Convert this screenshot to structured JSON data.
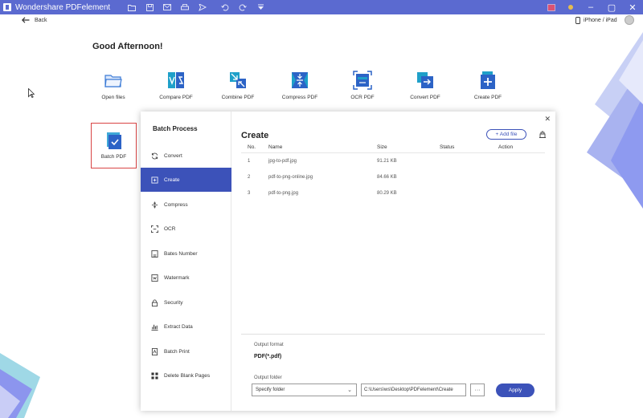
{
  "app": {
    "title": "Wondershare PDFelement"
  },
  "nav": {
    "back_label": "Back",
    "device_label": "iPhone / iPad"
  },
  "home": {
    "greeting": "Good Afternoon!",
    "tools": [
      {
        "label": "Open files"
      },
      {
        "label": "Compare PDF"
      },
      {
        "label": "Combine PDF"
      },
      {
        "label": "Compress PDF"
      },
      {
        "label": "OCR PDF"
      },
      {
        "label": "Convert PDF"
      },
      {
        "label": "Create PDF"
      }
    ],
    "batch_label": "Batch PDF"
  },
  "dialog": {
    "sidebar_title": "Batch Process",
    "sidebar_items": [
      {
        "label": "Convert"
      },
      {
        "label": "Create"
      },
      {
        "label": "Compress"
      },
      {
        "label": "OCR"
      },
      {
        "label": "Bates Number"
      },
      {
        "label": "Watermark"
      },
      {
        "label": "Security"
      },
      {
        "label": "Extract Data"
      },
      {
        "label": "Batch Print"
      },
      {
        "label": "Delete Blank Pages"
      }
    ],
    "active_item": "Create",
    "main_title": "Create",
    "add_file_label": "+ Add file",
    "columns": {
      "no": "No.",
      "name": "Name",
      "size": "Size",
      "status": "Status",
      "action": "Action"
    },
    "files": [
      {
        "no": "1",
        "name": "jpg-to-pdf.jpg",
        "size": "91.21 KB"
      },
      {
        "no": "2",
        "name": "pdf-to-png-online.jpg",
        "size": "84.66 KB"
      },
      {
        "no": "3",
        "name": "pdf-to-png.jpg",
        "size": "80.29 KB"
      }
    ],
    "output_format_label": "Output format",
    "output_format_value": "PDF(*.pdf)",
    "output_folder_label": "Output folder",
    "folder_select_value": "Specify folder",
    "folder_path_value": "C:\\Users\\ws\\Desktop\\PDFelement\\Create",
    "browse_label": "···",
    "apply_label": "Apply"
  },
  "colors": {
    "accent": "#3c52b9",
    "titlebar": "#5b6ad0",
    "highlight_border": "#d94545"
  }
}
